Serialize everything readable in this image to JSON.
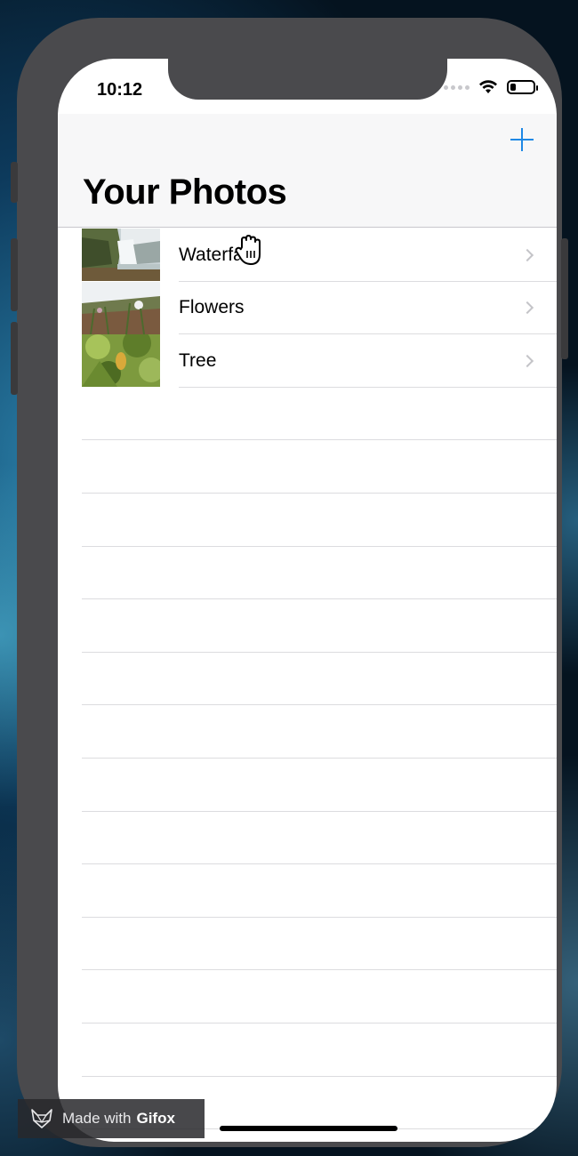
{
  "status_bar": {
    "time": "10:12",
    "icons": [
      "signal-dots-icon",
      "wifi-icon",
      "battery-icon"
    ],
    "battery_level": 0.25
  },
  "nav": {
    "title": "Your Photos",
    "add_icon": "plus-icon",
    "accent_color": "#1e88e5"
  },
  "photos": [
    {
      "label": "Waterfall",
      "thumbnail": "waterfall-photo"
    },
    {
      "label": "Flowers",
      "thumbnail": "flowers-photo"
    },
    {
      "label": "Tree",
      "thumbnail": "tree-photo"
    }
  ],
  "watermark": {
    "prefix": "Made with",
    "brand": "Gifox"
  }
}
